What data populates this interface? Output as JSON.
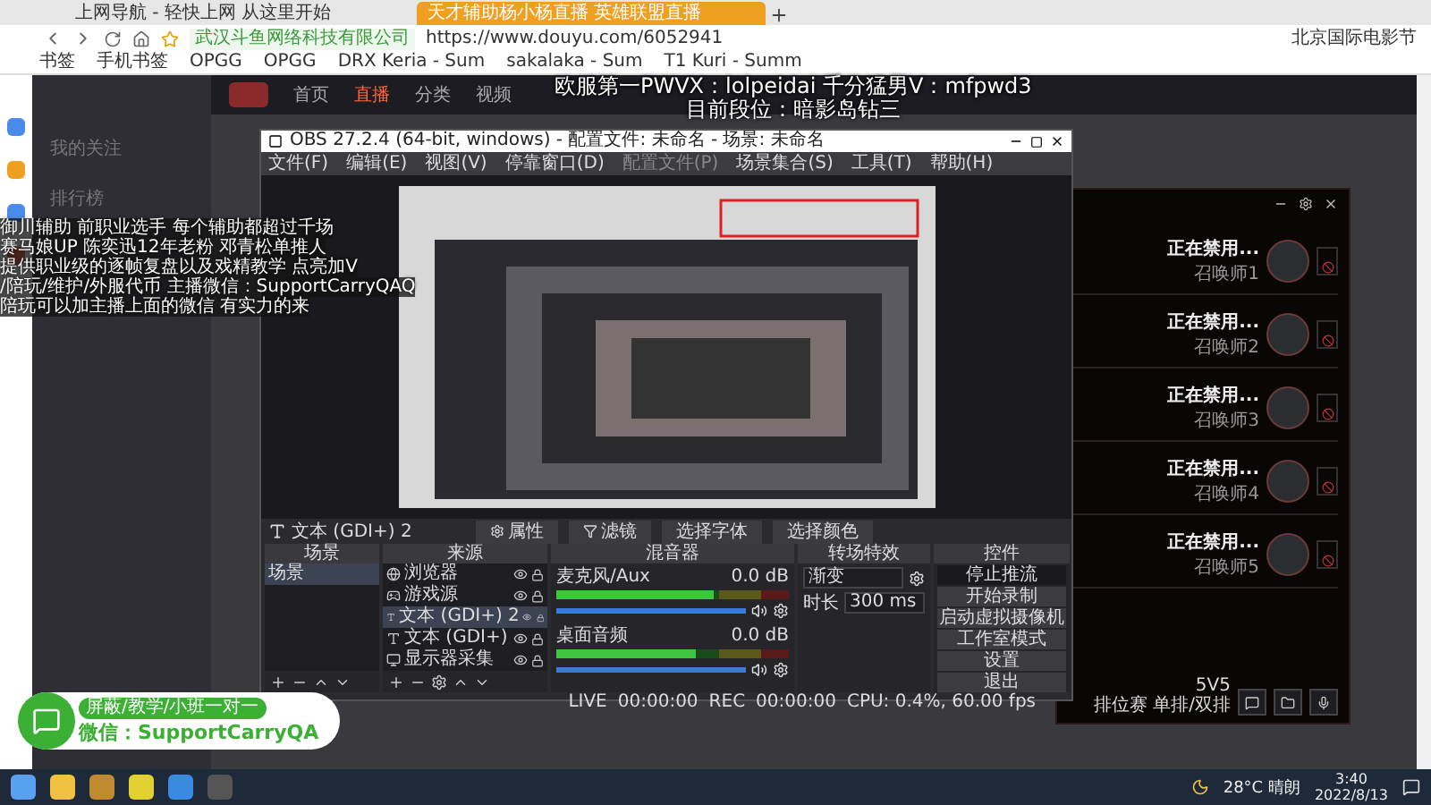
{
  "browser": {
    "tabs": [
      {
        "title": "上网导航 - 轻快上网 从这里开始",
        "selected": false
      },
      {
        "title": "天才辅助杨小杨直播 英雄联盟直播",
        "selected": true
      }
    ],
    "site_identity": "武汉斗鱼网络科技有限公司",
    "url": "https://www.douyu.com/6052941",
    "news": "北京国际电影节",
    "bookmarks": [
      "书签",
      "手机书签",
      "OPGG",
      "OPGG",
      "DRX Keria - Sum",
      "sakalaka - Sum",
      "T1 Kuri - Summ"
    ]
  },
  "site": {
    "nav": [
      {
        "label": "首页",
        "selected": false
      },
      {
        "label": "直播",
        "selected": true
      },
      {
        "label": "分类",
        "selected": false
      },
      {
        "label": "视频",
        "selected": false
      }
    ],
    "sidebar": [
      "我的关注",
      "排行榜"
    ]
  },
  "stream_overlay": {
    "title_lines": [
      "欧服第一PWVX：lolpeidai 千分猛男V：mfpwd3",
      "目前段位：暗影岛钻三"
    ],
    "info_lines": [
      "御川辅助 前职业选手 每个辅助都超过千场",
      "赛马娘UP 陈奕迅12年老粉 邓青松单推人",
      "提供职业级的逐帧复盘以及戏精教学 点亮加V",
      "/陪玩/维护/外服代币 主播微信：SupportCarryQAQ",
      "陪玩可以加主播上面的微信 有实力的来"
    ]
  },
  "obs": {
    "title": "OBS 27.2.4 (64-bit, windows) - 配置文件: 未命名 - 场景: 未命名",
    "menu": [
      {
        "label": "文件(F)",
        "disabled": false
      },
      {
        "label": "编辑(E)",
        "disabled": false
      },
      {
        "label": "视图(V)",
        "disabled": false
      },
      {
        "label": "停靠窗口(D)",
        "disabled": false
      },
      {
        "label": "配置文件(P)",
        "disabled": true
      },
      {
        "label": "场景集合(S)",
        "disabled": false
      },
      {
        "label": "工具(T)",
        "disabled": false
      },
      {
        "label": "帮助(H)",
        "disabled": false
      }
    ],
    "selected_source": "文本 (GDI+) 2",
    "toolbar": [
      "属性",
      "滤镜",
      "选择字体",
      "选择颜色"
    ],
    "scenes": {
      "title": "场景",
      "items": [
        {
          "name": "场景",
          "selected": true
        }
      ]
    },
    "sources": {
      "title": "来源",
      "items": [
        {
          "name": "浏览器",
          "kind": "browser",
          "selected": false
        },
        {
          "name": "游戏源",
          "kind": "game",
          "selected": false
        },
        {
          "name": "文本 (GDI+) 2",
          "kind": "text",
          "selected": true
        },
        {
          "name": "文本 (GDI+)",
          "kind": "text",
          "selected": false
        },
        {
          "name": "显示器采集",
          "kind": "display",
          "selected": false
        }
      ]
    },
    "mixer": {
      "title": "混音器",
      "channels": [
        {
          "name": "麦克风/Aux",
          "reading": "0.0 dB",
          "meter": {
            "level": 0.68
          },
          "volume": {
            "level": 1
          }
        },
        {
          "name": "桌面音频",
          "reading": "0.0 dB",
          "meter": {
            "level": 0.6
          },
          "volume": {
            "level": 1
          }
        }
      ]
    },
    "transitions": {
      "title": "转场特效",
      "type": "渐变",
      "duration_label": "时长",
      "duration": "300 ms"
    },
    "controls": {
      "title": "控件",
      "buttons": [
        {
          "label": "停止推流",
          "selected": true
        },
        {
          "label": "开始录制",
          "selected": false
        },
        {
          "label": "启动虚拟摄像机",
          "selected": false
        },
        {
          "label": "工作室模式",
          "selected": false
        },
        {
          "label": "设置",
          "selected": false
        },
        {
          "label": "退出",
          "selected": false
        }
      ]
    },
    "status": {
      "live_label": "LIVE",
      "live_time": "00:00:00",
      "rec_label": "REC",
      "rec_time": "00:00:00",
      "cpu": "CPU: 0.4%, 60.00 fps"
    }
  },
  "game_client": {
    "players": [
      {
        "status": "正在禁用...",
        "name": "召唤师1"
      },
      {
        "status": "正在禁用...",
        "name": "召唤师2"
      },
      {
        "status": "正在禁用...",
        "name": "召唤师3"
      },
      {
        "status": "正在禁用...",
        "name": "召唤师4"
      },
      {
        "status": "正在禁用...",
        "name": "召唤师5"
      }
    ],
    "mode": "5V5",
    "queue": "排位赛 单排/双排"
  },
  "wechat_badge": {
    "tagline": "屏蔽/教学/小班一对一",
    "contact": "微信：SupportCarryQA"
  },
  "taskbar": {
    "weather": "28°C 晴朗",
    "time": "3:40",
    "date": "2022/8/13"
  }
}
